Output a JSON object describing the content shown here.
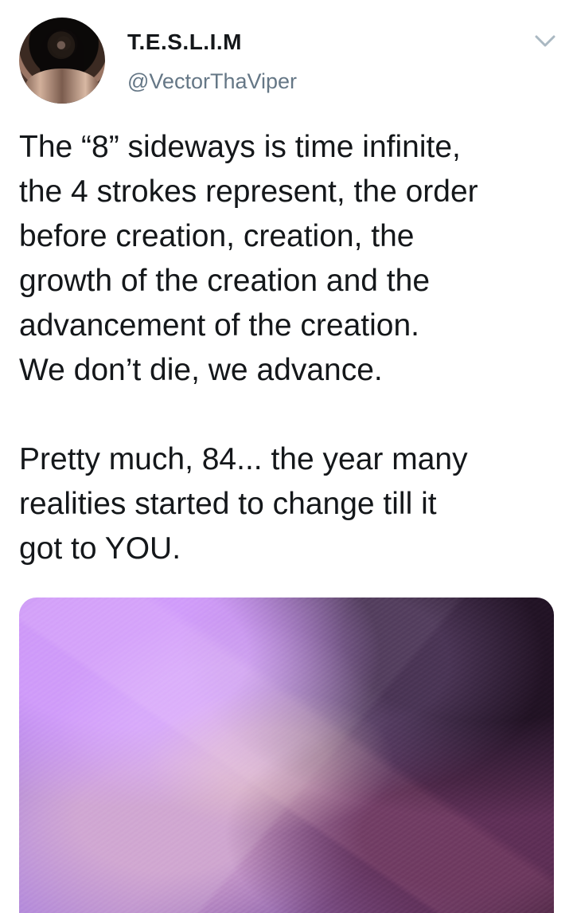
{
  "profile": {
    "display_name": "T.E.S.L.I.M",
    "handle": "@VectorThaViper",
    "avatar_icon": "profile-photo-avatar"
  },
  "menu": {
    "icon": "chevron-down-icon"
  },
  "tweet": {
    "text": "The “8” sideways is time infinite,\nthe 4 strokes represent, the order\nbefore creation, creation, the\ngrowth of the creation and the\nadvancement of the creation.\nWe don’t die, we advance.\n\nPretty much, 84... the year many\nrealities started to change till it\ngot to YOU."
  },
  "media": {
    "icon": "image-media"
  },
  "colors": {
    "text": "#14171a",
    "secondary_text": "#657786",
    "chevron": "#aab8c2"
  }
}
